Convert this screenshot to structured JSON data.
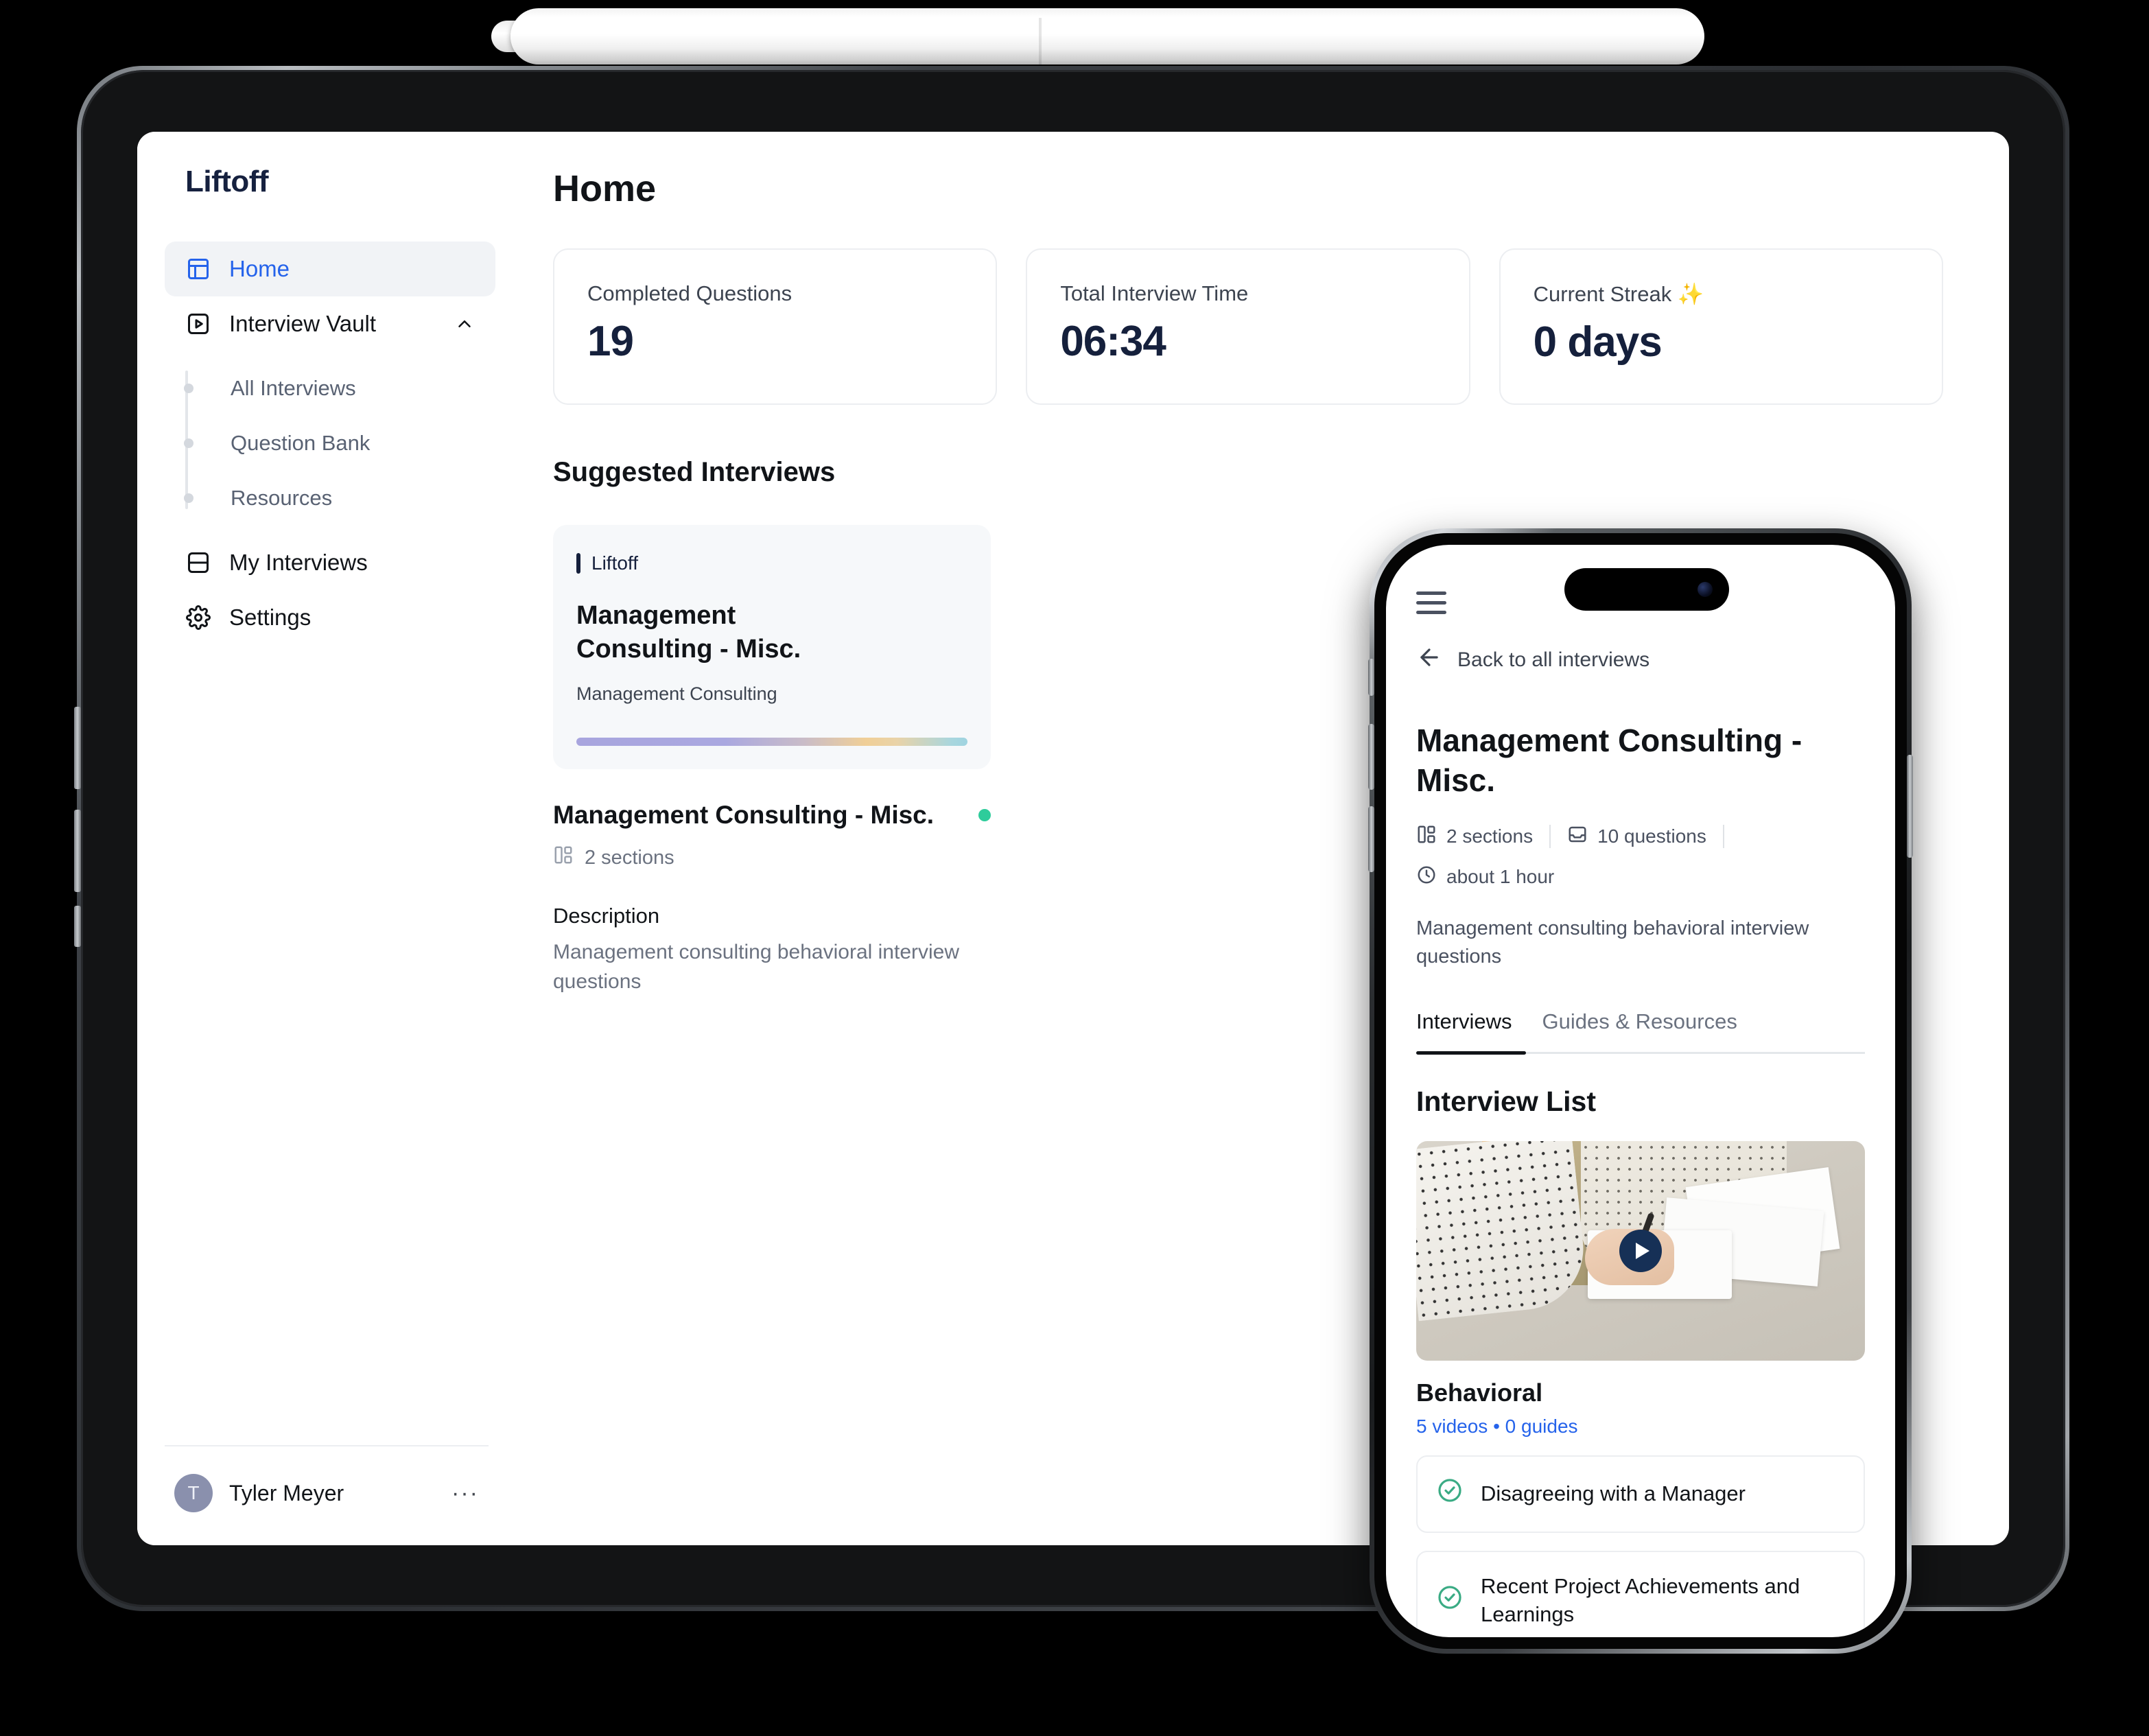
{
  "tablet": {
    "sidebar": {
      "brand": "Liftoff",
      "nav": [
        {
          "label": "Home",
          "icon": "layout-panel-icon",
          "active": true
        },
        {
          "label": "Interview Vault",
          "icon": "play-square-icon",
          "active": false,
          "expanded": true
        }
      ],
      "subnav": [
        {
          "label": "All Interviews"
        },
        {
          "label": "Question Bank"
        },
        {
          "label": "Resources"
        }
      ],
      "nav2": [
        {
          "label": "My Interviews",
          "icon": "panels-top-bottom-icon"
        },
        {
          "label": "Settings",
          "icon": "gear-icon"
        }
      ],
      "user": {
        "initial": "T",
        "name": "Tyler Meyer",
        "menu": "···"
      }
    },
    "main": {
      "page_title": "Home",
      "stats": [
        {
          "label": "Completed Questions",
          "value": "19"
        },
        {
          "label": "Total Interview Time",
          "value": "06:34"
        },
        {
          "label": "Current Streak ✨",
          "value": "0 days"
        }
      ],
      "section_title": "Suggested Interviews",
      "suggested_card": {
        "brand": "Liftoff",
        "title": "Management Consulting - Misc.",
        "subtitle": "Management Consulting"
      },
      "interview": {
        "title": "Management Consulting - Misc.",
        "sections": "2 sections",
        "description_heading": "Description",
        "description": "Management consulting behavioral interview questions"
      }
    }
  },
  "phone": {
    "back_label": "Back to all interviews",
    "title": "Management Consulting - Misc.",
    "sections": "2 sections",
    "questions": "10 questions",
    "duration": "about 1 hour",
    "description": "Management consulting behavioral interview questions",
    "tabs": [
      {
        "label": "Interviews",
        "active": true
      },
      {
        "label": "Guides & Resources",
        "active": false
      }
    ],
    "list_title": "Interview List",
    "video_card": {
      "title": "Behavioral",
      "meta": "5 videos • 0 guides"
    },
    "questions_list": [
      {
        "label": "Disagreeing with a Manager"
      },
      {
        "label": "Recent Project Achievements and Learnings"
      }
    ]
  },
  "colors": {
    "accent": "#2563eb",
    "title_dark": "#15203c",
    "status_green": "#2ecc9b",
    "muted": "#6b7280"
  }
}
